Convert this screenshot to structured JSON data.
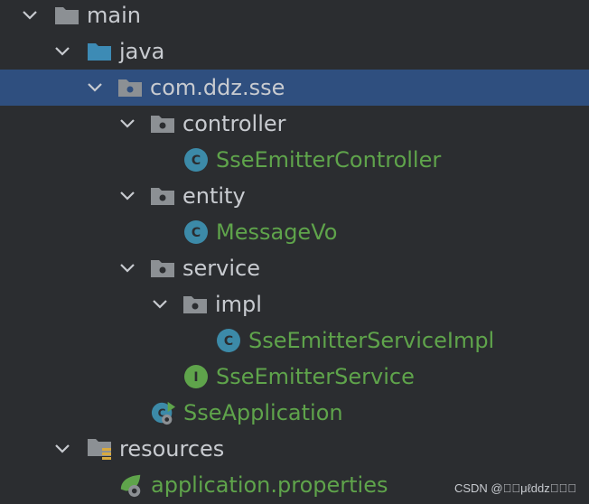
{
  "tree": {
    "main": "main",
    "java": "java",
    "package": "com.ddz.sse",
    "controller": "controller",
    "controller_class": "SseEmitterController",
    "entity": "entity",
    "entity_class": "MessageVo",
    "service": "service",
    "impl": "impl",
    "impl_class": "SseEmitterServiceImpl",
    "service_interface": "SseEmitterService",
    "application": "SseApplication",
    "resources": "resources",
    "properties": "application.properties"
  },
  "watermark": "CSDN @\u0000\u0000μℓddz\u0000\u0000\u0000",
  "colors": {
    "background": "#2b2d30",
    "selection": "#2f4f7f",
    "class_text": "#5fa44b",
    "folder_blue": "#3d8bb5",
    "folder_gray": "#8c9094"
  }
}
